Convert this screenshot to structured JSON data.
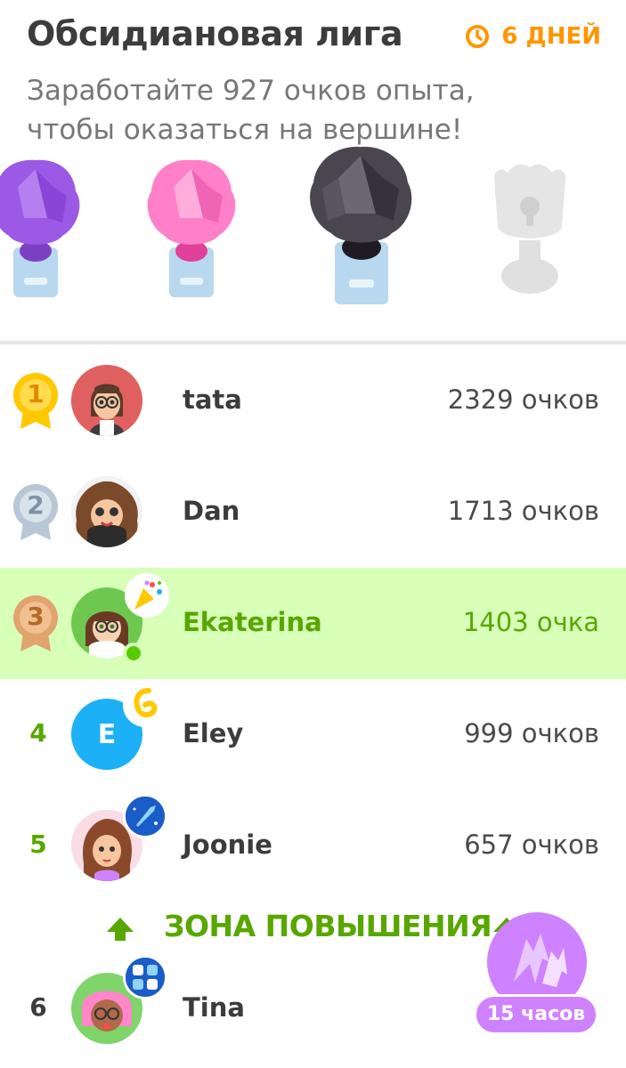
{
  "header": {
    "title": "Обсидиановая лига",
    "timer_label": "6 ДНЕЙ",
    "subtitle_line1": "Заработайте 927 очков опыта,",
    "subtitle_line2": "чтобы оказаться на вершине!"
  },
  "trophies": [
    {
      "name": "amethyst-trophy",
      "color": "#9b59e6"
    },
    {
      "name": "pearl-trophy",
      "color": "#ff7fc8"
    },
    {
      "name": "obsidian-trophy",
      "color": "#4a4650"
    },
    {
      "name": "locked-diamond-trophy",
      "color": "#e5e5e5"
    }
  ],
  "leaderboard": [
    {
      "rank": "1",
      "name": "tata",
      "score": "2329 очков",
      "medal": "gold"
    },
    {
      "rank": "2",
      "name": "Dan",
      "score": "1713 очков",
      "medal": "silver"
    },
    {
      "rank": "3",
      "name": "Ekaterina",
      "score": "1403 очка",
      "medal": "bronze",
      "current_user": true
    },
    {
      "rank": "4",
      "name": "Eley",
      "score": "999 очков",
      "avatar_letter": "E"
    },
    {
      "rank": "5",
      "name": "Joonie",
      "score": "657 очков"
    },
    {
      "rank": "6",
      "name": "Tina",
      "score": ""
    }
  ],
  "promotion_zone": {
    "label": "ЗОНА ПОВЫШЕНИЯ"
  },
  "fab": {
    "label": "15 часов"
  },
  "colors": {
    "accent_green": "#58a700",
    "current_row_bg": "#d7ffb8",
    "timer_orange": "#ff9600",
    "fab_purple": "#ce82ff"
  }
}
